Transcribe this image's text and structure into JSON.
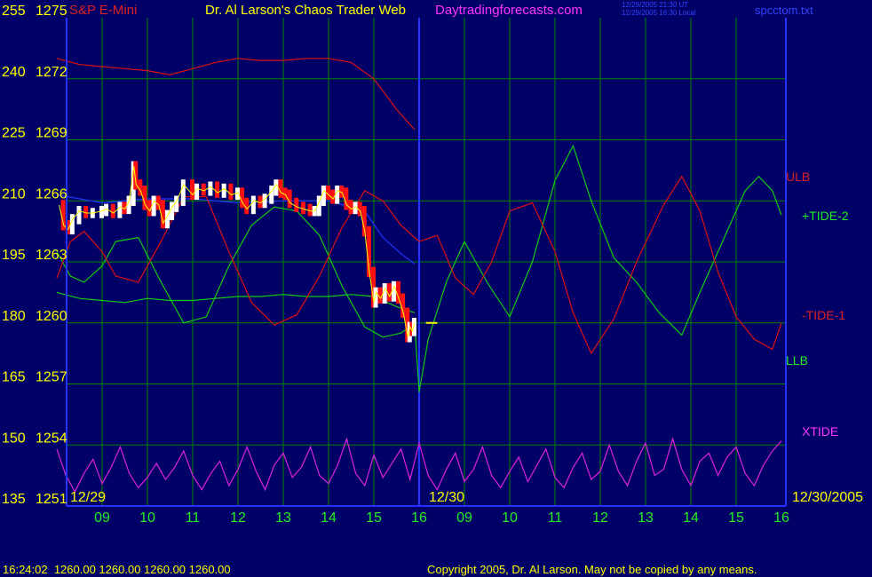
{
  "header": {
    "instrument": "S&P E-Mini",
    "title": "Dr. Al Larson's Chaos Trader Web",
    "site": "Daytradingforecasts.com",
    "time_ut": "12/29/2005 21:30 UT",
    "time_local": "12/29/2005 16:30 Local",
    "file": "spcctom.txt"
  },
  "footer": {
    "quote": "16:24:02  1260.00 1260.00 1260.00 1260.00",
    "copyright": "Copyright 2005, Dr. Al Larson. May not be copied by any means."
  },
  "colors": {
    "background": "#000066",
    "grid": "#008800",
    "frame": "#2233ff",
    "price_down": "#ff1111",
    "price_up": "#ffffff",
    "tide_green": "#11cc11",
    "tide_red": "#dd1111",
    "xtide": "#dd22dd",
    "blue_line": "#2233ff",
    "label_yellow": "#ffff00",
    "label_green": "#22ee22",
    "label_magenta": "#ff33ff"
  },
  "chart_data": {
    "type": "line",
    "left_axis": {
      "primary": [
        "255",
        "240",
        "225",
        "210",
        "195",
        "180",
        "165",
        "150",
        "135"
      ],
      "secondary": [
        "1275",
        "1272",
        "1269",
        "1266",
        "1263",
        "1260",
        "1257",
        "1254",
        "1251"
      ],
      "ylim": [
        1251,
        1275
      ]
    },
    "x_ticks": [
      "09",
      "10",
      "11",
      "12",
      "13",
      "14",
      "15",
      "16",
      "09",
      "10",
      "11",
      "12",
      "13",
      "14",
      "15",
      "16"
    ],
    "date_labels": [
      "12/29",
      "12/30",
      "12/30/2005"
    ],
    "xlim": [
      8,
      24
    ],
    "series": [
      {
        "name": "ULB",
        "values": [
          [
            8,
            1273.0
          ],
          [
            8.5,
            1272.7
          ],
          [
            9,
            1272.6
          ],
          [
            9.5,
            1272.5
          ],
          [
            10,
            1272.4
          ],
          [
            10.5,
            1272.2
          ],
          [
            11,
            1272.5
          ],
          [
            11.5,
            1272.8
          ],
          [
            12,
            1273.0
          ],
          [
            12.5,
            1272.9
          ],
          [
            13,
            1272.9
          ],
          [
            13.5,
            1273.0
          ],
          [
            14,
            1273.0
          ],
          [
            14.5,
            1272.8
          ],
          [
            15,
            1272.0
          ],
          [
            15.5,
            1270.5
          ],
          [
            15.9,
            1269.5
          ]
        ]
      },
      {
        "name": "LLB",
        "values": [
          [
            8,
            1261.5
          ],
          [
            8.5,
            1261.2
          ],
          [
            9,
            1261.1
          ],
          [
            9.5,
            1261.0
          ],
          [
            10,
            1261.2
          ],
          [
            10.5,
            1261.1
          ],
          [
            11,
            1261.1
          ],
          [
            11.5,
            1261.2
          ],
          [
            12,
            1261.3
          ],
          [
            12.5,
            1261.3
          ],
          [
            13,
            1261.4
          ],
          [
            13.5,
            1261.3
          ],
          [
            14,
            1261.3
          ],
          [
            14.5,
            1261.4
          ],
          [
            15,
            1261.3
          ],
          [
            15.5,
            1260.8
          ],
          [
            15.9,
            1260.5
          ]
        ]
      },
      {
        "name": "Blue",
        "values": [
          [
            8,
            1266.3
          ],
          [
            9,
            1265.9
          ],
          [
            10,
            1266.1
          ],
          [
            11,
            1266.1
          ],
          [
            12,
            1265.9
          ],
          [
            13,
            1266.0
          ],
          [
            14,
            1266.0
          ],
          [
            14.8,
            1265.5
          ],
          [
            15.2,
            1264.2
          ],
          [
            15.6,
            1263.4
          ],
          [
            15.9,
            1262.9
          ]
        ]
      },
      {
        "name": "+TIDE-2",
        "values": [
          [
            8,
            1263.5
          ],
          [
            8.3,
            1262.3
          ],
          [
            8.6,
            1262.0
          ],
          [
            9,
            1262.8
          ],
          [
            9.3,
            1264.0
          ],
          [
            9.8,
            1264.2
          ],
          [
            10.3,
            1262.0
          ],
          [
            10.8,
            1260.0
          ],
          [
            11.3,
            1260.3
          ],
          [
            11.8,
            1262.8
          ],
          [
            12.3,
            1264.8
          ],
          [
            12.8,
            1265.7
          ],
          [
            13.3,
            1265.5
          ],
          [
            13.8,
            1264.3
          ],
          [
            14.3,
            1261.8
          ],
          [
            14.8,
            1259.8
          ],
          [
            15.2,
            1259.3
          ],
          [
            15.6,
            1259.5
          ],
          [
            15.9,
            1260.0
          ],
          [
            16.0,
            1256.6
          ],
          [
            16.2,
            1259.2
          ],
          [
            16.6,
            1262.0
          ],
          [
            17.0,
            1264.0
          ],
          [
            17.5,
            1262.0
          ],
          [
            18.0,
            1260.3
          ],
          [
            18.5,
            1263.0
          ],
          [
            19.0,
            1267.0
          ],
          [
            19.4,
            1268.7
          ],
          [
            19.8,
            1266.0
          ],
          [
            20.3,
            1263.2
          ],
          [
            20.8,
            1262.0
          ],
          [
            21.3,
            1260.5
          ],
          [
            21.8,
            1259.4
          ],
          [
            22.2,
            1261.5
          ],
          [
            22.8,
            1264.5
          ],
          [
            23.2,
            1266.5
          ],
          [
            23.5,
            1267.2
          ],
          [
            23.8,
            1266.5
          ],
          [
            24,
            1265.3
          ]
        ]
      },
      {
        "name": "-TIDE-1",
        "values": [
          [
            8,
            1262.2
          ],
          [
            8.3,
            1264.0
          ],
          [
            8.6,
            1264.5
          ],
          [
            9,
            1263.5
          ],
          [
            9.3,
            1262.3
          ],
          [
            9.8,
            1262.0
          ],
          [
            10.3,
            1264.0
          ],
          [
            10.8,
            1266.2
          ],
          [
            11.3,
            1266.2
          ],
          [
            11.8,
            1263.5
          ],
          [
            12.3,
            1261.0
          ],
          [
            12.8,
            1259.9
          ],
          [
            13.3,
            1260.4
          ],
          [
            13.8,
            1262.3
          ],
          [
            14.3,
            1264.7
          ],
          [
            14.8,
            1266.5
          ],
          [
            15.2,
            1266.0
          ],
          [
            15.6,
            1264.8
          ],
          [
            16.0,
            1264.0
          ],
          [
            16.4,
            1264.3
          ],
          [
            16.8,
            1262.2
          ],
          [
            17.2,
            1261.4
          ],
          [
            17.6,
            1263.0
          ],
          [
            18.0,
            1265.5
          ],
          [
            18.5,
            1265.9
          ],
          [
            19.0,
            1263.5
          ],
          [
            19.4,
            1260.5
          ],
          [
            19.8,
            1258.5
          ],
          [
            20.3,
            1260.2
          ],
          [
            20.8,
            1263.0
          ],
          [
            21.4,
            1265.8
          ],
          [
            21.8,
            1267.2
          ],
          [
            22.2,
            1265.5
          ],
          [
            22.6,
            1262.5
          ],
          [
            23.0,
            1260.3
          ],
          [
            23.4,
            1259.2
          ],
          [
            23.8,
            1258.7
          ],
          [
            24,
            1260.0
          ]
        ]
      },
      {
        "name": "XTIDE",
        "values": [
          [
            8,
            1253.8
          ],
          [
            8.2,
            1252.5
          ],
          [
            8.4,
            1251.7
          ],
          [
            8.6,
            1252.6
          ],
          [
            8.8,
            1253.3
          ],
          [
            9.0,
            1252.1
          ],
          [
            9.2,
            1252.9
          ],
          [
            9.4,
            1253.9
          ],
          [
            9.6,
            1252.6
          ],
          [
            9.8,
            1251.9
          ],
          [
            10.0,
            1252.4
          ],
          [
            10.2,
            1253.1
          ],
          [
            10.4,
            1252.3
          ],
          [
            10.6,
            1252.9
          ],
          [
            10.8,
            1253.7
          ],
          [
            11.0,
            1252.5
          ],
          [
            11.2,
            1251.8
          ],
          [
            11.4,
            1252.6
          ],
          [
            11.6,
            1253.2
          ],
          [
            11.8,
            1252.0
          ],
          [
            12.0,
            1252.8
          ],
          [
            12.2,
            1253.9
          ],
          [
            12.4,
            1252.7
          ],
          [
            12.6,
            1251.8
          ],
          [
            12.8,
            1253.0
          ],
          [
            13.0,
            1253.6
          ],
          [
            13.2,
            1252.4
          ],
          [
            13.4,
            1252.9
          ],
          [
            13.6,
            1253.9
          ],
          [
            13.8,
            1252.5
          ],
          [
            14.0,
            1252.1
          ],
          [
            14.2,
            1253.0
          ],
          [
            14.4,
            1254.3
          ],
          [
            14.6,
            1252.6
          ],
          [
            14.8,
            1252.0
          ],
          [
            15.0,
            1253.5
          ],
          [
            15.2,
            1252.4
          ],
          [
            15.4,
            1253.1
          ],
          [
            15.6,
            1253.8
          ],
          [
            15.8,
            1252.3
          ],
          [
            16.0,
            1254.1
          ],
          [
            16.2,
            1252.5
          ],
          [
            16.4,
            1251.8
          ],
          [
            16.6,
            1252.8
          ],
          [
            16.8,
            1253.6
          ],
          [
            17.0,
            1252.2
          ],
          [
            17.2,
            1252.8
          ],
          [
            17.4,
            1253.9
          ],
          [
            17.6,
            1252.5
          ],
          [
            17.8,
            1251.9
          ],
          [
            18.0,
            1252.7
          ],
          [
            18.2,
            1253.4
          ],
          [
            18.4,
            1252.2
          ],
          [
            18.6,
            1253.0
          ],
          [
            18.8,
            1253.8
          ],
          [
            19.0,
            1252.4
          ],
          [
            19.2,
            1251.9
          ],
          [
            19.4,
            1252.9
          ],
          [
            19.6,
            1253.6
          ],
          [
            19.8,
            1252.3
          ],
          [
            20.0,
            1252.7
          ],
          [
            20.2,
            1254.0
          ],
          [
            20.4,
            1252.7
          ],
          [
            20.6,
            1252.0
          ],
          [
            20.8,
            1253.2
          ],
          [
            21.0,
            1254.1
          ],
          [
            21.2,
            1252.5
          ],
          [
            21.4,
            1252.8
          ],
          [
            21.6,
            1254.3
          ],
          [
            21.8,
            1252.8
          ],
          [
            22.0,
            1252.0
          ],
          [
            22.2,
            1253.2
          ],
          [
            22.4,
            1253.6
          ],
          [
            22.6,
            1252.5
          ],
          [
            22.8,
            1253.4
          ],
          [
            23.0,
            1253.9
          ],
          [
            23.2,
            1252.6
          ],
          [
            23.4,
            1252.0
          ],
          [
            23.6,
            1253.0
          ],
          [
            23.8,
            1253.7
          ],
          [
            24.0,
            1254.2
          ]
        ]
      }
    ],
    "price": [
      [
        8.05,
        1265.8
      ],
      [
        8.15,
        1264.8
      ],
      [
        8.25,
        1264.6
      ],
      [
        8.35,
        1265.1
      ],
      [
        8.5,
        1265.5
      ],
      [
        8.65,
        1265.4
      ],
      [
        8.8,
        1265.4
      ],
      [
        9.0,
        1265.5
      ],
      [
        9.1,
        1265.6
      ],
      [
        9.25,
        1265.4
      ],
      [
        9.4,
        1265.7
      ],
      [
        9.5,
        1265.6
      ],
      [
        9.6,
        1266.0
      ],
      [
        9.7,
        1267.7
      ],
      [
        9.75,
        1266.8
      ],
      [
        9.85,
        1266.5
      ],
      [
        9.95,
        1265.8
      ],
      [
        10.05,
        1265.5
      ],
      [
        10.15,
        1266.0
      ],
      [
        10.25,
        1265.8
      ],
      [
        10.35,
        1264.9
      ],
      [
        10.45,
        1265.3
      ],
      [
        10.55,
        1265.7
      ],
      [
        10.65,
        1266.0
      ],
      [
        10.8,
        1266.8
      ],
      [
        11.0,
        1266.3
      ],
      [
        11.1,
        1266.6
      ],
      [
        11.25,
        1266.5
      ],
      [
        11.4,
        1266.7
      ],
      [
        11.55,
        1266.4
      ],
      [
        11.7,
        1266.6
      ],
      [
        11.85,
        1266.3
      ],
      [
        12.0,
        1266.4
      ],
      [
        12.1,
        1265.9
      ],
      [
        12.2,
        1265.6
      ],
      [
        12.35,
        1266.0
      ],
      [
        12.5,
        1265.9
      ],
      [
        12.6,
        1266.1
      ],
      [
        12.75,
        1266.5
      ],
      [
        12.85,
        1266.8
      ],
      [
        12.95,
        1266.4
      ],
      [
        13.05,
        1266.3
      ],
      [
        13.15,
        1265.9
      ],
      [
        13.3,
        1265.7
      ],
      [
        13.45,
        1265.6
      ],
      [
        13.6,
        1265.5
      ],
      [
        13.7,
        1265.5
      ],
      [
        13.8,
        1266.0
      ],
      [
        13.9,
        1266.5
      ],
      [
        14.0,
        1266.3
      ],
      [
        14.1,
        1266.1
      ],
      [
        14.2,
        1266.5
      ],
      [
        14.3,
        1266.4
      ],
      [
        14.4,
        1265.8
      ],
      [
        14.5,
        1265.6
      ],
      [
        14.6,
        1265.7
      ],
      [
        14.7,
        1265.5
      ],
      [
        14.8,
        1264.5
      ],
      [
        14.9,
        1262.5
      ],
      [
        15.0,
        1261.0
      ],
      [
        15.05,
        1261.5
      ],
      [
        15.15,
        1261.2
      ],
      [
        15.25,
        1261.7
      ],
      [
        15.35,
        1261.3
      ],
      [
        15.45,
        1261.8
      ],
      [
        15.55,
        1261.2
      ],
      [
        15.65,
        1260.5
      ],
      [
        15.75,
        1259.3
      ],
      [
        15.8,
        1259.8
      ],
      [
        15.85,
        1259.6
      ],
      [
        15.9,
        1260.0
      ]
    ],
    "last_price": 1260.0,
    "series_labels": [
      "ULB",
      "+TIDE-2",
      "-TIDE-1",
      "LLB",
      "XTIDE"
    ]
  }
}
